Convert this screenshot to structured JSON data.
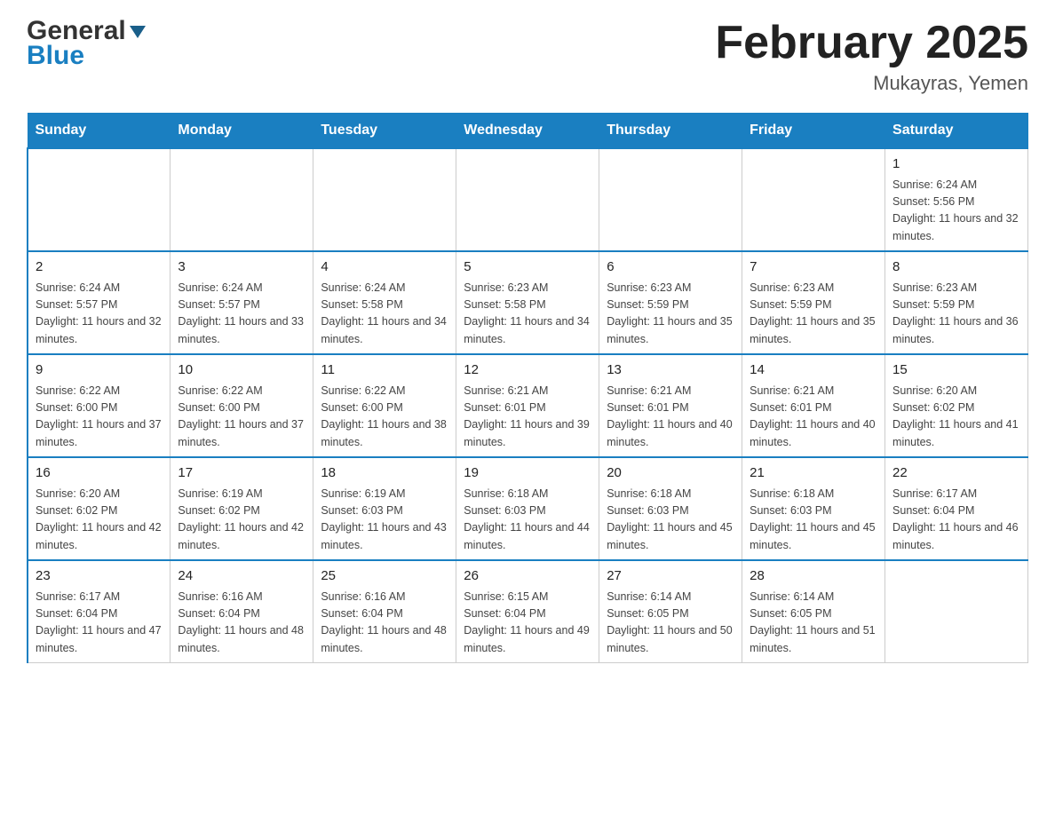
{
  "header": {
    "logo_line1": "General",
    "logo_line2": "Blue",
    "month_title": "February 2025",
    "location": "Mukayras, Yemen"
  },
  "days_of_week": [
    "Sunday",
    "Monday",
    "Tuesday",
    "Wednesday",
    "Thursday",
    "Friday",
    "Saturday"
  ],
  "weeks": [
    [
      {
        "day": "",
        "sunrise": "",
        "sunset": "",
        "daylight": ""
      },
      {
        "day": "",
        "sunrise": "",
        "sunset": "",
        "daylight": ""
      },
      {
        "day": "",
        "sunrise": "",
        "sunset": "",
        "daylight": ""
      },
      {
        "day": "",
        "sunrise": "",
        "sunset": "",
        "daylight": ""
      },
      {
        "day": "",
        "sunrise": "",
        "sunset": "",
        "daylight": ""
      },
      {
        "day": "",
        "sunrise": "",
        "sunset": "",
        "daylight": ""
      },
      {
        "day": "1",
        "sunrise": "Sunrise: 6:24 AM",
        "sunset": "Sunset: 5:56 PM",
        "daylight": "Daylight: 11 hours and 32 minutes."
      }
    ],
    [
      {
        "day": "2",
        "sunrise": "Sunrise: 6:24 AM",
        "sunset": "Sunset: 5:57 PM",
        "daylight": "Daylight: 11 hours and 32 minutes."
      },
      {
        "day": "3",
        "sunrise": "Sunrise: 6:24 AM",
        "sunset": "Sunset: 5:57 PM",
        "daylight": "Daylight: 11 hours and 33 minutes."
      },
      {
        "day": "4",
        "sunrise": "Sunrise: 6:24 AM",
        "sunset": "Sunset: 5:58 PM",
        "daylight": "Daylight: 11 hours and 34 minutes."
      },
      {
        "day": "5",
        "sunrise": "Sunrise: 6:23 AM",
        "sunset": "Sunset: 5:58 PM",
        "daylight": "Daylight: 11 hours and 34 minutes."
      },
      {
        "day": "6",
        "sunrise": "Sunrise: 6:23 AM",
        "sunset": "Sunset: 5:59 PM",
        "daylight": "Daylight: 11 hours and 35 minutes."
      },
      {
        "day": "7",
        "sunrise": "Sunrise: 6:23 AM",
        "sunset": "Sunset: 5:59 PM",
        "daylight": "Daylight: 11 hours and 35 minutes."
      },
      {
        "day": "8",
        "sunrise": "Sunrise: 6:23 AM",
        "sunset": "Sunset: 5:59 PM",
        "daylight": "Daylight: 11 hours and 36 minutes."
      }
    ],
    [
      {
        "day": "9",
        "sunrise": "Sunrise: 6:22 AM",
        "sunset": "Sunset: 6:00 PM",
        "daylight": "Daylight: 11 hours and 37 minutes."
      },
      {
        "day": "10",
        "sunrise": "Sunrise: 6:22 AM",
        "sunset": "Sunset: 6:00 PM",
        "daylight": "Daylight: 11 hours and 37 minutes."
      },
      {
        "day": "11",
        "sunrise": "Sunrise: 6:22 AM",
        "sunset": "Sunset: 6:00 PM",
        "daylight": "Daylight: 11 hours and 38 minutes."
      },
      {
        "day": "12",
        "sunrise": "Sunrise: 6:21 AM",
        "sunset": "Sunset: 6:01 PM",
        "daylight": "Daylight: 11 hours and 39 minutes."
      },
      {
        "day": "13",
        "sunrise": "Sunrise: 6:21 AM",
        "sunset": "Sunset: 6:01 PM",
        "daylight": "Daylight: 11 hours and 40 minutes."
      },
      {
        "day": "14",
        "sunrise": "Sunrise: 6:21 AM",
        "sunset": "Sunset: 6:01 PM",
        "daylight": "Daylight: 11 hours and 40 minutes."
      },
      {
        "day": "15",
        "sunrise": "Sunrise: 6:20 AM",
        "sunset": "Sunset: 6:02 PM",
        "daylight": "Daylight: 11 hours and 41 minutes."
      }
    ],
    [
      {
        "day": "16",
        "sunrise": "Sunrise: 6:20 AM",
        "sunset": "Sunset: 6:02 PM",
        "daylight": "Daylight: 11 hours and 42 minutes."
      },
      {
        "day": "17",
        "sunrise": "Sunrise: 6:19 AM",
        "sunset": "Sunset: 6:02 PM",
        "daylight": "Daylight: 11 hours and 42 minutes."
      },
      {
        "day": "18",
        "sunrise": "Sunrise: 6:19 AM",
        "sunset": "Sunset: 6:03 PM",
        "daylight": "Daylight: 11 hours and 43 minutes."
      },
      {
        "day": "19",
        "sunrise": "Sunrise: 6:18 AM",
        "sunset": "Sunset: 6:03 PM",
        "daylight": "Daylight: 11 hours and 44 minutes."
      },
      {
        "day": "20",
        "sunrise": "Sunrise: 6:18 AM",
        "sunset": "Sunset: 6:03 PM",
        "daylight": "Daylight: 11 hours and 45 minutes."
      },
      {
        "day": "21",
        "sunrise": "Sunrise: 6:18 AM",
        "sunset": "Sunset: 6:03 PM",
        "daylight": "Daylight: 11 hours and 45 minutes."
      },
      {
        "day": "22",
        "sunrise": "Sunrise: 6:17 AM",
        "sunset": "Sunset: 6:04 PM",
        "daylight": "Daylight: 11 hours and 46 minutes."
      }
    ],
    [
      {
        "day": "23",
        "sunrise": "Sunrise: 6:17 AM",
        "sunset": "Sunset: 6:04 PM",
        "daylight": "Daylight: 11 hours and 47 minutes."
      },
      {
        "day": "24",
        "sunrise": "Sunrise: 6:16 AM",
        "sunset": "Sunset: 6:04 PM",
        "daylight": "Daylight: 11 hours and 48 minutes."
      },
      {
        "day": "25",
        "sunrise": "Sunrise: 6:16 AM",
        "sunset": "Sunset: 6:04 PM",
        "daylight": "Daylight: 11 hours and 48 minutes."
      },
      {
        "day": "26",
        "sunrise": "Sunrise: 6:15 AM",
        "sunset": "Sunset: 6:04 PM",
        "daylight": "Daylight: 11 hours and 49 minutes."
      },
      {
        "day": "27",
        "sunrise": "Sunrise: 6:14 AM",
        "sunset": "Sunset: 6:05 PM",
        "daylight": "Daylight: 11 hours and 50 minutes."
      },
      {
        "day": "28",
        "sunrise": "Sunrise: 6:14 AM",
        "sunset": "Sunset: 6:05 PM",
        "daylight": "Daylight: 11 hours and 51 minutes."
      },
      {
        "day": "",
        "sunrise": "",
        "sunset": "",
        "daylight": ""
      }
    ]
  ]
}
